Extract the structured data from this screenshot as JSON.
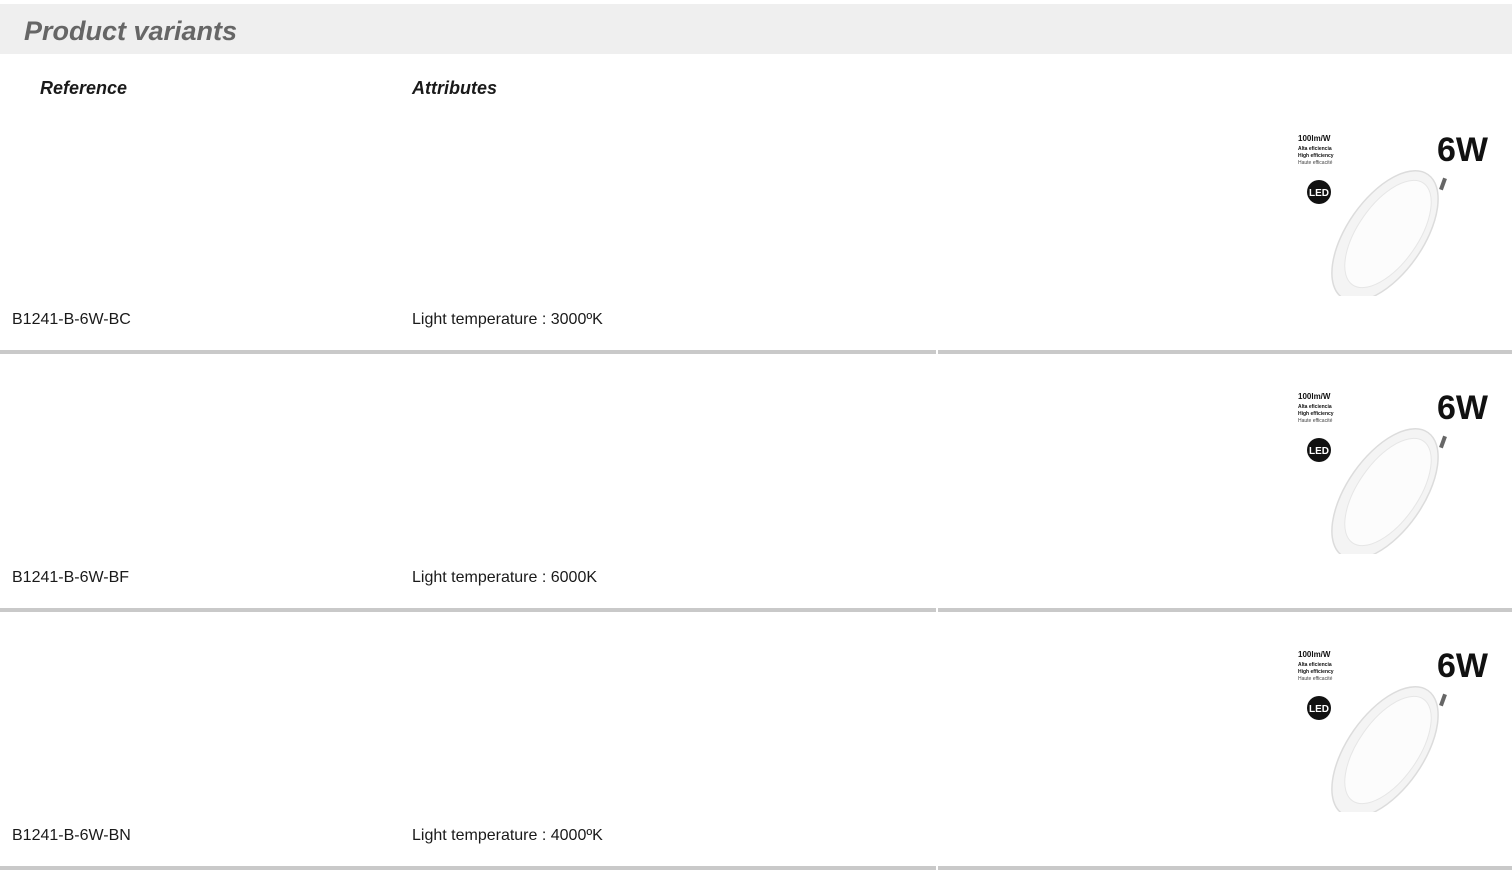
{
  "section": {
    "title": "Product variants"
  },
  "columns": {
    "reference": "Reference",
    "attributes": "Attributes"
  },
  "variants": [
    {
      "reference": "B1241-B-6W-BC",
      "attribute": "Light temperature : 3000ºK",
      "image": {
        "efficiency": "100lm/W",
        "line1": "Alta eficiencia",
        "line2": "High efficiency",
        "line3": "Haute efficacité",
        "badge": "LED",
        "watt": "6W"
      }
    },
    {
      "reference": "B1241-B-6W-BF",
      "attribute": "Light temperature : 6000K",
      "image": {
        "efficiency": "100lm/W",
        "line1": "Alta eficiencia",
        "line2": "High efficiency",
        "line3": "Haute efficacité",
        "badge": "LED",
        "watt": "6W"
      }
    },
    {
      "reference": "B1241-B-6W-BN",
      "attribute": "Light temperature : 4000ºK",
      "image": {
        "efficiency": "100lm/W",
        "line1": "Alta eficiencia",
        "line2": "High efficiency",
        "line3": "Haute efficacité",
        "badge": "LED",
        "watt": "6W"
      }
    }
  ]
}
